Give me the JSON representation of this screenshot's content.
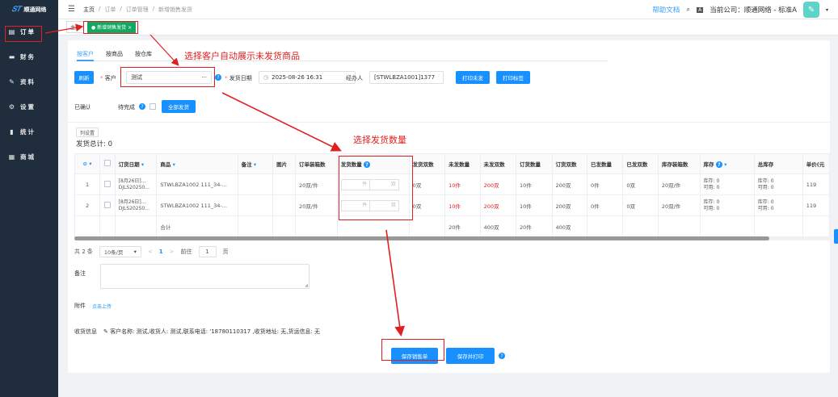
{
  "app": {
    "logo_text": "顺通网络",
    "logo_mark": "[mark]"
  },
  "sidebar": {
    "items": [
      {
        "label": "订单",
        "icon": "order-icon",
        "glyph": "▤"
      },
      {
        "label": "财务",
        "icon": "finance-icon",
        "glyph": "▬"
      },
      {
        "label": "资料",
        "icon": "data-icon",
        "glyph": "✎"
      },
      {
        "label": "设置",
        "icon": "gear-icon",
        "glyph": "⚙"
      },
      {
        "label": "统计",
        "icon": "stats-icon",
        "glyph": "▮"
      },
      {
        "label": "商城",
        "icon": "store-icon",
        "glyph": "▦"
      }
    ]
  },
  "header": {
    "breadcrumb": [
      "主页",
      "/",
      "订单",
      "/",
      "订单管理",
      "/",
      "新增销售发货"
    ],
    "help": "帮助文档",
    "company": "当前公司：顺通网络 - 标准A"
  },
  "tags": [
    {
      "label": "主页"
    },
    {
      "label": "● 新增销售发货 ×"
    }
  ],
  "tabs": [
    "按客户",
    "按商品",
    "按仓库"
  ],
  "form": {
    "refresh_btn": "刷新",
    "customer_label": "客户",
    "customer_value": "测试",
    "customer_more": "···",
    "date_label": "发货日期",
    "date_value": "2025-08-26 16:31",
    "handler_label": "经办人",
    "handler_value": "[STWLBZA1001]1377",
    "print_unsent_btn": "打印未发",
    "print_label_btn": "打印标签",
    "confirmed_label": "已确认",
    "pending_label": "待完成",
    "ship_all_btn": "全部发货",
    "col_settings_btn": "列设置",
    "total_label": "发货总计: 0"
  },
  "table": {
    "columns": [
      "",
      "",
      "订货日期",
      "商品",
      "备注",
      "图片",
      "订单装箱数",
      "发货数量",
      "发货双数",
      "未发数量",
      "未发双数",
      "订货数量",
      "订货双数",
      "已发数量",
      "已发双数",
      "库存装箱数",
      "库存",
      "总库存",
      "单价(元"
    ],
    "rows": [
      {
        "idx": "1",
        "date": "[8月26日]...",
        "doc": "DJLS20250...",
        "product": "STWLBZA1002 111_34-...",
        "pack": "20双/件",
        "qty_ph1": "件",
        "qty_ph2": "双",
        "ship_pairs": "0双",
        "unsent_qty": "10件",
        "unsent_pairs": "200双",
        "order_qty": "10件",
        "order_pairs": "200双",
        "sent_qty": "0件",
        "sent_pairs": "0双",
        "stock_pack": "20双/件",
        "stock_a": "库存: 0",
        "stock_b": "可用: 0",
        "total_a": "库存: 0",
        "total_b": "可用: 0",
        "price": "119"
      },
      {
        "idx": "2",
        "date": "[8月26日]...",
        "doc": "DJLS20250...",
        "product": "STWLBZA1002 111_34-...",
        "pack": "20双/件",
        "qty_ph1": "件",
        "qty_ph2": "双",
        "ship_pairs": "0双",
        "unsent_qty": "10件",
        "unsent_pairs": "200双",
        "order_qty": "10件",
        "order_pairs": "200双",
        "sent_qty": "0件",
        "sent_pairs": "0双",
        "stock_pack": "20双/件",
        "stock_a": "库存: 0",
        "stock_b": "可用: 0",
        "total_a": "库存: 0",
        "total_b": "可用: 0",
        "price": "119"
      }
    ],
    "summary": {
      "label": "合计",
      "unsent_qty": "20件",
      "unsent_pairs": "400双",
      "order_qty": "20件",
      "order_pairs": "400双"
    }
  },
  "pagination": {
    "total": "共 2 条",
    "page_size": "10条/页",
    "prev": "<",
    "page": "1",
    "next": ">",
    "goto": "前往",
    "goto_value": "1",
    "page_suffix": "页"
  },
  "remark_label": "备注",
  "attachment": {
    "label": "附件",
    "link": "点击上传"
  },
  "receive": {
    "label": "收货信息",
    "text": "✎ 客户名称: 测试,收货人: 测试,联系电话: '18780110317 ,收货地址: 无,货运信息: 无"
  },
  "actions": {
    "save": "保存销售单",
    "save_print": "保存并打印"
  },
  "annotations": {
    "a1": "选择客户自动展示未发货商品",
    "a2": "选择发货数量"
  }
}
